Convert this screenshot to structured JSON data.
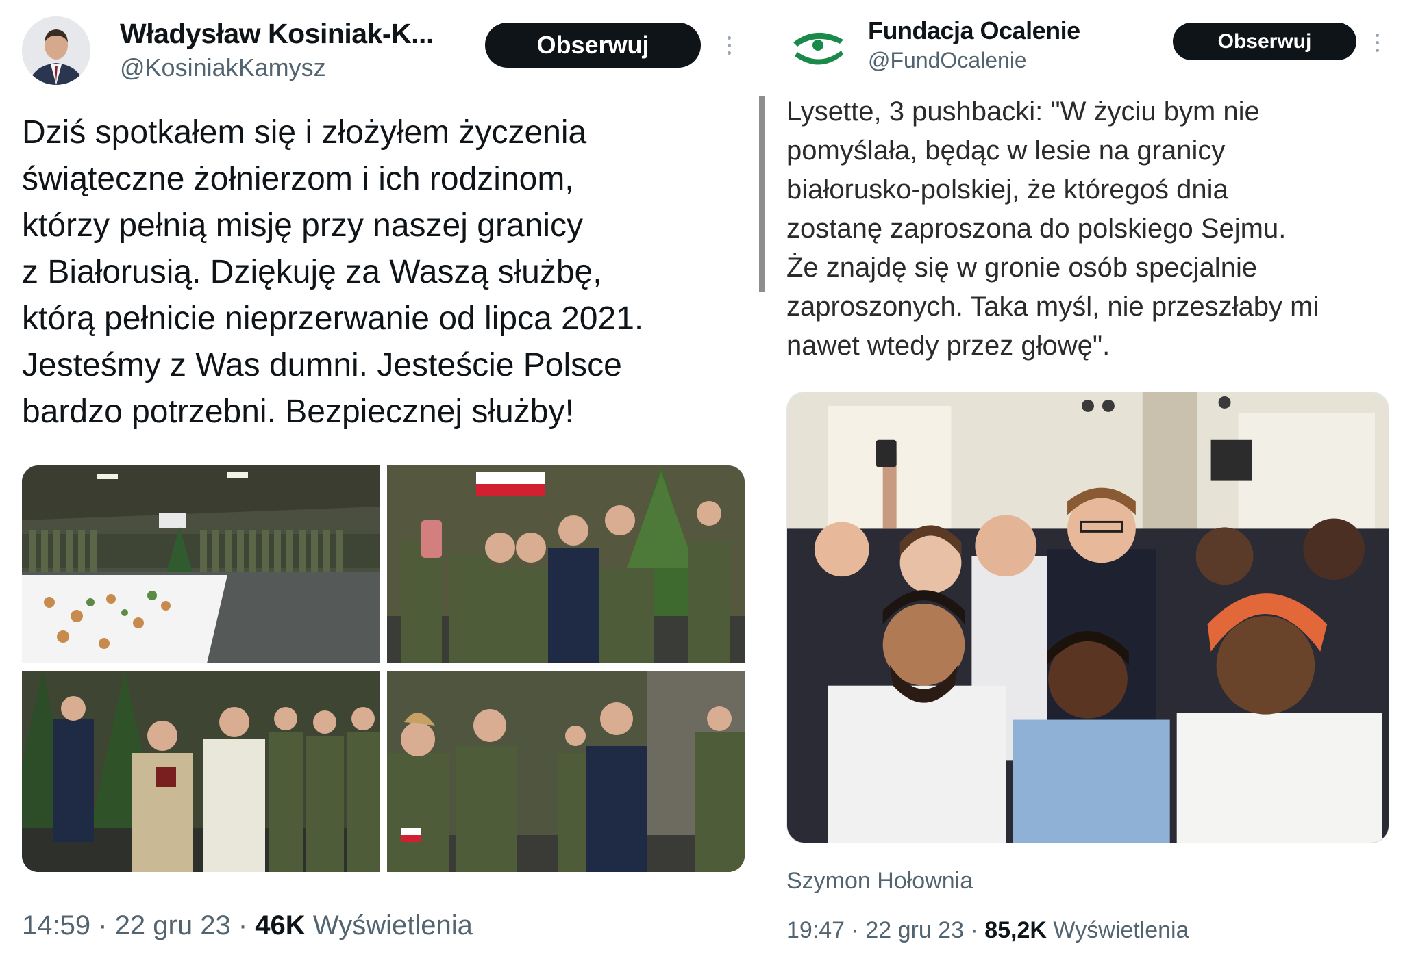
{
  "left_tweet": {
    "author_name": "Władysław Kosiniak-K...",
    "author_handle": "@KosiniakKamysz",
    "follow_label": "Obserwuj",
    "text": "Dziś spotkałem się i złożyłem życzenia\nświąteczne żołnierzom i ich rodzinom,\nktórzy pełnią misję przy naszej granicy\nz Białorusią. Dziękuję za Waszą służbę,\nktórą pełnicie nieprzerwanie od lipca 2021.\nJesteśmy z Was dumni. Jesteście Polsce\nbardzo potrzebni. Bezpiecznej służby!",
    "time": "14:59",
    "date": "22 gru 23",
    "views_count": "46K",
    "views_label": "Wyświetlenia",
    "separator": "·"
  },
  "right_tweet": {
    "author_name": "Fundacja Ocalenie",
    "author_handle": "@FundOcalenie",
    "follow_label": "Obserwuj",
    "text": "Lysette, 3 pushbacki: \"W życiu bym nie\npomyślała, będąc  w lesie na granicy\nbiałorusko-polskiej, że któregoś dnia\nzostanę zaproszona do polskiego Sejmu.\nŻe znajdę się w gronie osób specjalnie\nzaproszonych. Taka myśl, nie przeszłaby mi\nnawet wtedy przez głowę\".",
    "photo_caption": "Szymon Hołownia",
    "time": "19:47",
    "date": "22 gru 23",
    "views_count": "85,2K",
    "views_label": "Wyświetlenia",
    "separator": "·"
  },
  "colors": {
    "text_primary": "#0f1419",
    "text_secondary": "#536471",
    "button_bg": "#0f1419",
    "logo_green": "#1a8a4a"
  },
  "icons": {
    "more": "more-vertical-icon",
    "logo": "fundacja-ocalenie-logo-icon"
  }
}
